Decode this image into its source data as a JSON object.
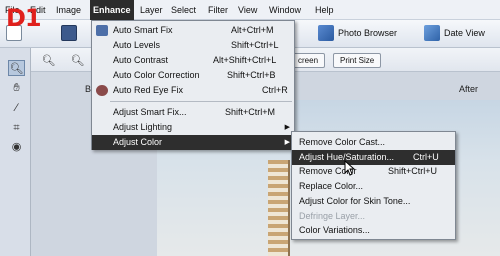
{
  "menubar": {
    "items": [
      "File",
      "Edit",
      "Image",
      "Enhance",
      "Layer",
      "Select",
      "Filter",
      "View",
      "Window",
      "Help"
    ],
    "active": "Enhance"
  },
  "toolbar": {
    "photo_browser": "Photo Browser",
    "date_view": "Date View"
  },
  "options": {
    "screen_btn": "creen",
    "print_size_btn": "Print Size"
  },
  "canvas": {
    "before_label": "B",
    "after_label": "After"
  },
  "badge": "D1",
  "enhance_menu": {
    "items": [
      {
        "label": "Auto Smart Fix",
        "shortcut": "Alt+Ctrl+M"
      },
      {
        "label": "Auto Levels",
        "shortcut": "Shift+Ctrl+L"
      },
      {
        "label": "Auto Contrast",
        "shortcut": "Alt+Shift+Ctrl+L"
      },
      {
        "label": "Auto Color Correction",
        "shortcut": "Shift+Ctrl+B"
      },
      {
        "label": "Auto Red Eye Fix",
        "shortcut": "Ctrl+R"
      },
      {
        "label": "Adjust Smart Fix...",
        "shortcut": "Shift+Ctrl+M"
      },
      {
        "label": "Adjust Lighting",
        "shortcut": ""
      },
      {
        "label": "Adjust Color",
        "shortcut": ""
      }
    ]
  },
  "adjust_color_menu": {
    "items": [
      {
        "label": "Remove Color Cast...",
        "shortcut": ""
      },
      {
        "label": "Adjust Hue/Saturation...",
        "shortcut": "Ctrl+U"
      },
      {
        "label": "Remove Color",
        "shortcut": "Shift+Ctrl+U"
      },
      {
        "label": "Replace Color...",
        "shortcut": ""
      },
      {
        "label": "Adjust Color for Skin Tone...",
        "shortcut": ""
      },
      {
        "label": "Defringe Layer...",
        "shortcut": ""
      },
      {
        "label": "Color Variations...",
        "shortcut": ""
      }
    ]
  },
  "colors": {
    "menu_highlight": "#2e2e2e",
    "badge_red": "#e0201c"
  },
  "icons": [
    "zoom-icon",
    "hand-icon",
    "brush-icon",
    "crop-icon",
    "red-eye-icon",
    "new-file-icon",
    "save-icon",
    "photo-browser-icon",
    "date-view-icon",
    "auto-smart-fix-icon",
    "red-eye-fix-icon"
  ]
}
